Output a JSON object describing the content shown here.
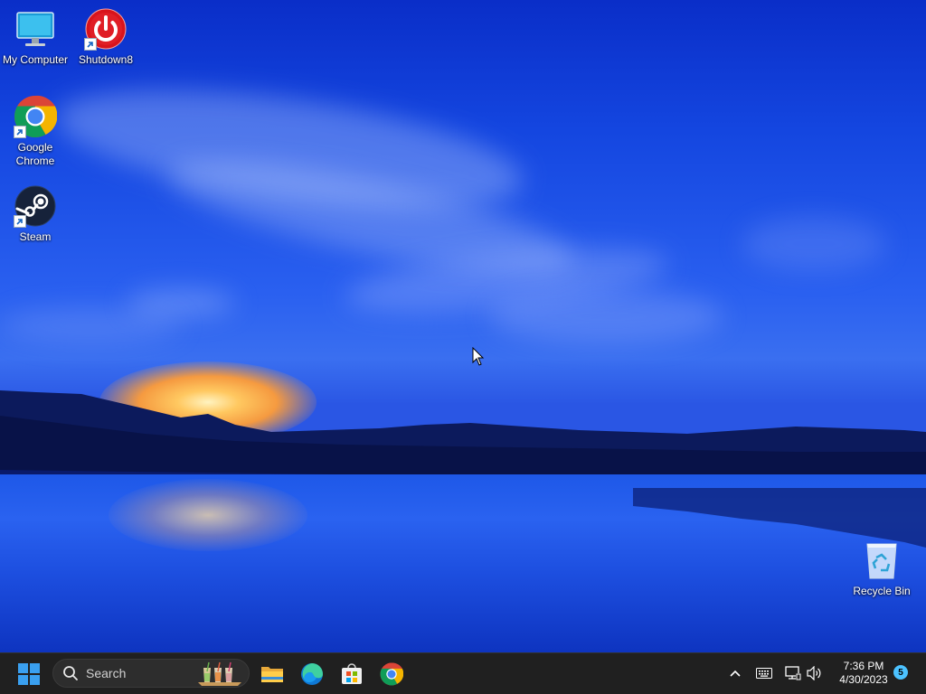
{
  "desktop": {
    "icons": [
      {
        "label": "My Computer",
        "icon": "monitor-icon"
      },
      {
        "label": "Shutdown8",
        "icon": "power-icon"
      },
      {
        "label": "Google Chrome",
        "icon": "chrome-icon"
      },
      {
        "label": "Steam",
        "icon": "steam-icon"
      },
      {
        "label": "Recycle Bin",
        "icon": "recycle-bin-icon"
      }
    ]
  },
  "taskbar": {
    "search_label": "Search",
    "pinned": [
      {
        "name": "File Explorer",
        "icon": "folder-icon"
      },
      {
        "name": "Microsoft Edge",
        "icon": "edge-icon"
      },
      {
        "name": "Microsoft Store",
        "icon": "store-icon"
      },
      {
        "name": "Google Chrome",
        "icon": "chrome-icon"
      }
    ],
    "tray": {
      "icons": [
        "chevron-up-icon",
        "keyboard-icon",
        "network-icon",
        "volume-icon"
      ],
      "time": "7:36 PM",
      "date": "4/30/2023",
      "notification_count": "5"
    }
  },
  "colors": {
    "taskbar_bg": "#202020",
    "accent": "#4cc2ff",
    "windows_logo": "#3aa0f0"
  }
}
